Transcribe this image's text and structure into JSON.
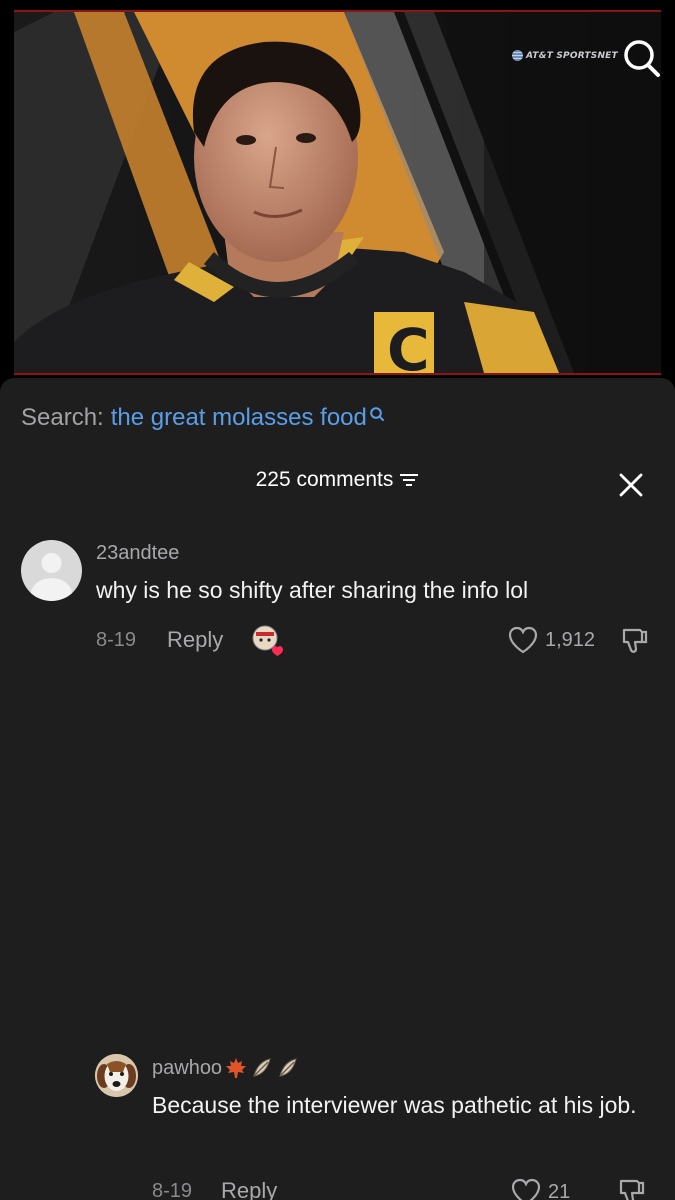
{
  "video": {
    "broadcaster_logo": "AT&T SPORTSNET",
    "jersey_letter": "C"
  },
  "search": {
    "label": "Search:",
    "query": "the great molasses food",
    "icon": "search-icon"
  },
  "comments_panel": {
    "count_label": "225 comments",
    "sort_icon": "filter-icon",
    "close_icon": "close-icon"
  },
  "comments": [
    {
      "username": "23andtee",
      "text": "why is he so shifty after sharing the info lol",
      "date": "8-19",
      "reply_label": "Reply",
      "likes": "1,912",
      "liked_by_creator": true
    },
    {
      "username": "pawhoo",
      "username_badges": [
        "maple-leaf",
        "feather",
        "feather"
      ],
      "text": "Because the interviewer was pathetic at his job.",
      "date": "8-19",
      "reply_label": "Reply",
      "likes": "21"
    }
  ],
  "colors": {
    "sheet_bg": "#1e1e1f",
    "link_blue": "#5a9ee8",
    "creator_heart": "#ff2b55"
  }
}
